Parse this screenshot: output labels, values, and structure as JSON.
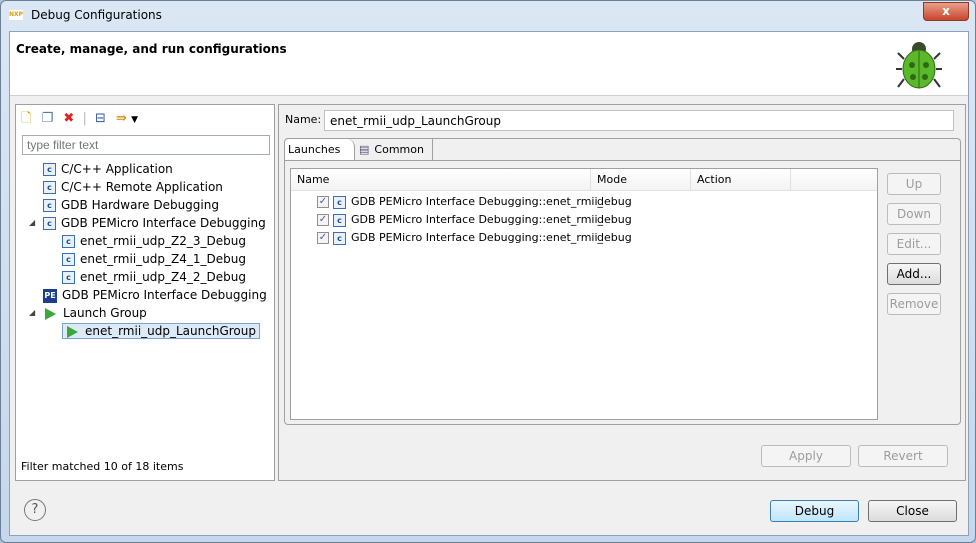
{
  "window": {
    "title": "Debug Configurations",
    "close": "x"
  },
  "header": {
    "title": "Create, manage, and run configurations"
  },
  "left": {
    "filter_placeholder": "type filter text",
    "tree": [
      {
        "label": "C/C++ Application",
        "icon": "c-icon",
        "level": 0
      },
      {
        "label": "C/C++ Remote Application",
        "icon": "c-icon",
        "level": 0
      },
      {
        "label": "GDB Hardware Debugging",
        "icon": "c-icon",
        "level": 0
      },
      {
        "label": "GDB PEMicro Interface Debugging",
        "icon": "c-icon",
        "level": 0,
        "expanded": true
      },
      {
        "label": "enet_rmii_udp_Z2_3_Debug",
        "icon": "c-icon",
        "level": 1
      },
      {
        "label": "enet_rmii_udp_Z4_1_Debug",
        "icon": "c-icon",
        "level": 1
      },
      {
        "label": "enet_rmii_udp_Z4_2_Debug",
        "icon": "c-icon",
        "level": 1
      },
      {
        "label": "GDB PEMicro Interface Debugging",
        "icon": "pe-icon",
        "level": 0
      },
      {
        "label": "Launch Group",
        "icon": "launch-icon",
        "level": 0,
        "expanded": true
      },
      {
        "label": "enet_rmii_udp_LaunchGroup",
        "icon": "launch-icon",
        "level": 1,
        "selected": true
      }
    ],
    "status": "Filter matched 10 of 18 items"
  },
  "right": {
    "name_label": "Name:",
    "name_value": "enet_rmii_udp_LaunchGroup",
    "tabs": [
      {
        "label": "Launches",
        "active": true
      },
      {
        "label": "Common"
      }
    ],
    "columns": [
      "Name",
      "Mode",
      "Action"
    ],
    "rows": [
      {
        "name": "GDB PEMicro Interface Debugging::enet_rmii_",
        "mode": "debug",
        "action": "",
        "checked": true
      },
      {
        "name": "GDB PEMicro Interface Debugging::enet_rmii_",
        "mode": "debug",
        "action": "",
        "checked": true
      },
      {
        "name": "GDB PEMicro Interface Debugging::enet_rmii_",
        "mode": "debug",
        "action": "",
        "checked": true
      }
    ],
    "side_buttons": {
      "up": "Up",
      "down": "Down",
      "edit": "Edit...",
      "add": "Add...",
      "remove": "Remove"
    },
    "apply": "Apply",
    "revert": "Revert"
  },
  "footer": {
    "help": "?",
    "debug": "Debug",
    "close": "Close"
  }
}
